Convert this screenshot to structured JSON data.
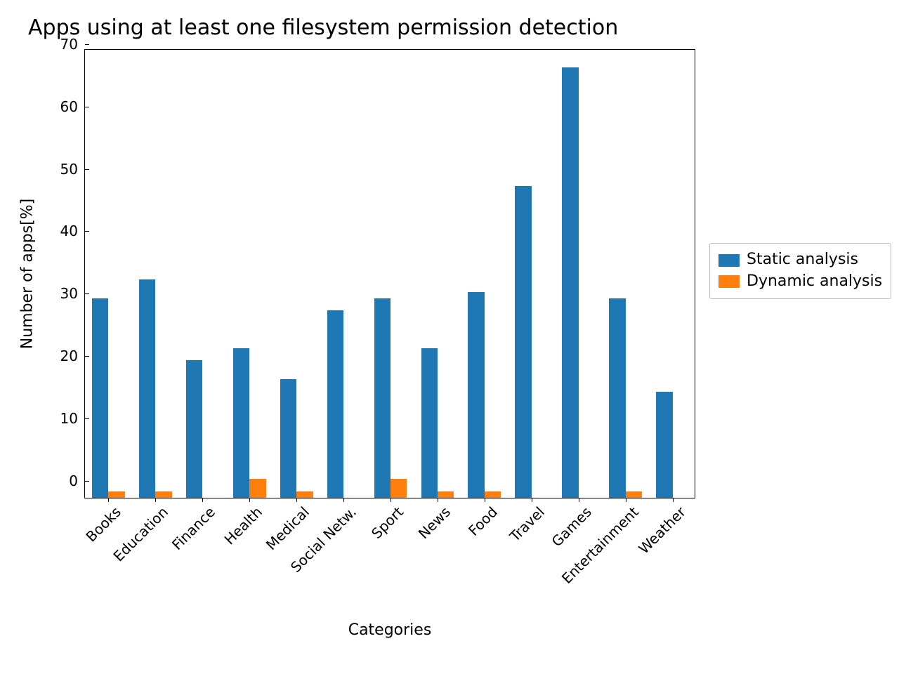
{
  "title": "Apps using at least one filesystem permission detection",
  "xlabel": "Categories",
  "ylabel": "Number of apps[%]",
  "legend": {
    "static": "Static analysis",
    "dynamic": "Dynamic analysis"
  },
  "colors": {
    "static": "#1f77b4",
    "dynamic": "#ff7f0e"
  },
  "chart_data": {
    "type": "bar",
    "title": "Apps using at least one filesystem permission detection",
    "xlabel": "Categories",
    "ylabel": "Number of apps[%]",
    "ylim": [
      0,
      72
    ],
    "yticks": [
      0,
      10,
      20,
      30,
      40,
      50,
      60,
      70
    ],
    "categories": [
      "Books",
      "Education",
      "Finance",
      "Health",
      "Medical",
      "Social Netw.",
      "Sport",
      "News",
      "Food",
      "Travel",
      "Games",
      "Entertainment",
      "Weather"
    ],
    "series": [
      {
        "name": "Static analysis",
        "values": [
          32,
          35,
          22,
          24,
          19,
          30,
          32,
          24,
          33,
          50,
          69,
          32,
          17
        ]
      },
      {
        "name": "Dynamic analysis",
        "values": [
          1,
          1,
          0,
          3,
          1,
          0,
          3,
          1,
          1,
          0,
          0,
          1,
          0
        ]
      }
    ]
  }
}
